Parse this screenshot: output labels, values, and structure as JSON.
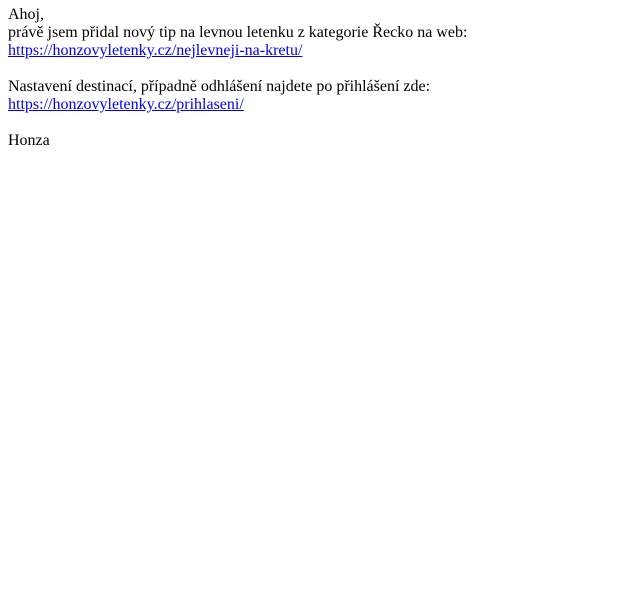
{
  "email": {
    "greeting": "Ahoj,",
    "intro": "právě jsem přidal nový tip na levnou letenku z kategorie Řecko na web:",
    "tip_link": "https://honzovyletenky.cz/nejlevneji-na-kretu/",
    "settings_text": "Nastavení destinací, případně odhlášení najdete po přihlášení zde:",
    "login_link": "https://honzovyletenky.cz/prihlaseni/",
    "signature": "Honza"
  },
  "colors": {
    "text": "#000000",
    "link": "#0000ee",
    "background": "#ffffff"
  }
}
